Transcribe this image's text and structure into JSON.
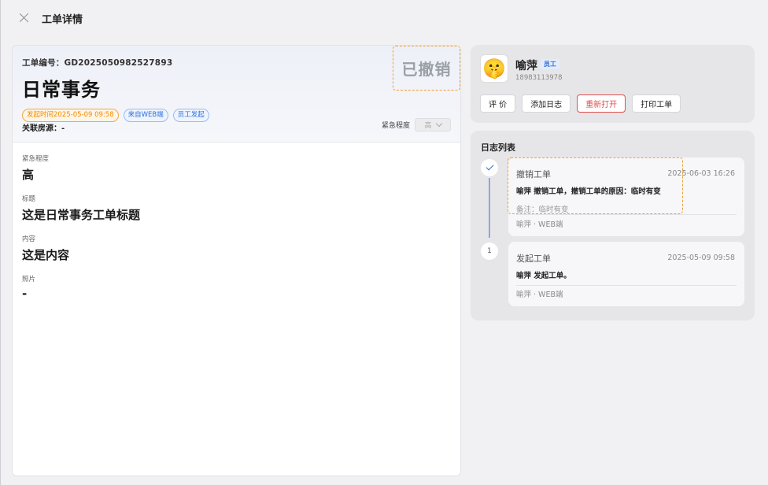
{
  "header": {
    "title": "工单详情"
  },
  "ticket": {
    "order_no": "工单编号：GD2025050982527893",
    "title": "日常事务",
    "stamp": "已撤销",
    "tags": [
      "发起时间2025-05-09 09:58",
      "来自WEB端",
      "员工发起"
    ],
    "related": "关联房源：-",
    "urgency_label": "紧急程度",
    "urgency_value": "高"
  },
  "fields": [
    {
      "label": "紧急程度",
      "value": "高"
    },
    {
      "label": "标题",
      "value": "这是日常事务工单标题"
    },
    {
      "label": "内容",
      "value": "这是内容"
    },
    {
      "label": "照片",
      "value": "-"
    }
  ],
  "user": {
    "name": "喻萍",
    "badge": "员工",
    "phone": "18983113978",
    "avatar_icon": "🤫",
    "actions": [
      "评 价",
      "添加日志",
      "重新打开",
      "打印工单"
    ]
  },
  "log": {
    "title": "日志列表",
    "items": [
      {
        "marker": "check",
        "action": "撤销工单",
        "time": "2025-06-03 16:26",
        "desc": "喻萍 撤销工单，撤销工单的原因：临时有变",
        "note": "备注：临时有变",
        "source": "喻萍 · WEB端"
      },
      {
        "marker": "1",
        "action": "发起工单",
        "time": "2025-05-09 09:58",
        "desc": "喻萍 发起工单。",
        "note": "",
        "source": "喻萍 · WEB端"
      }
    ]
  },
  "colors": {
    "accent": "#2f6fd6",
    "danger": "#e24c4c",
    "warning": "#e8a23a"
  }
}
